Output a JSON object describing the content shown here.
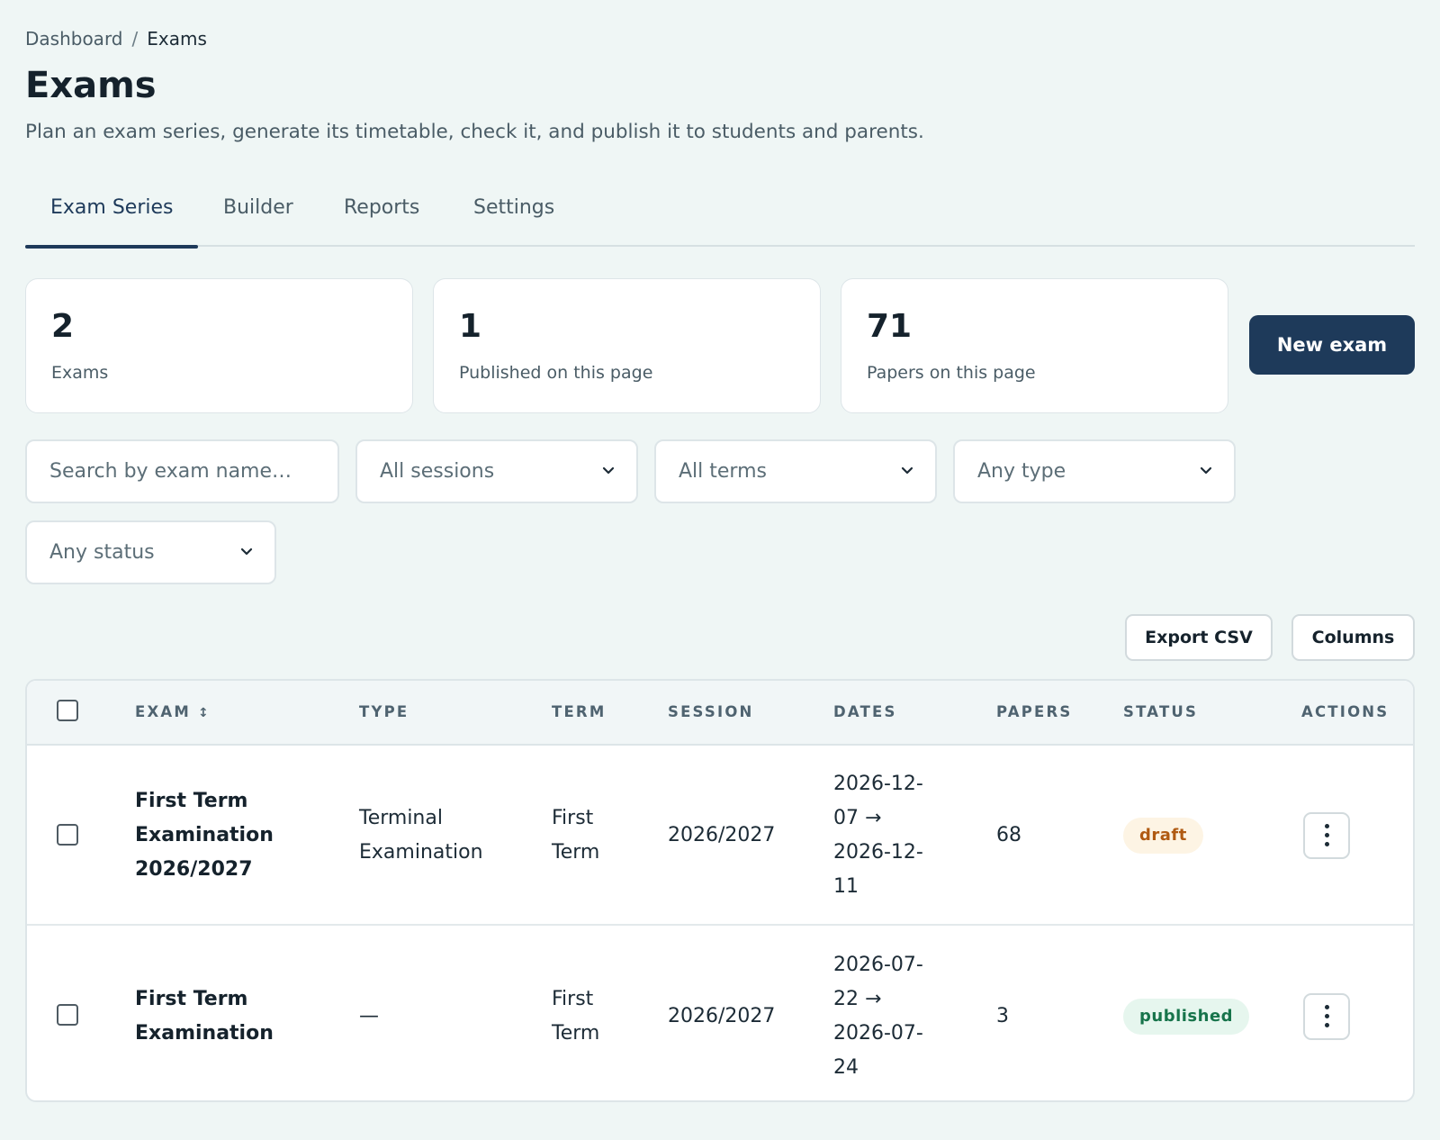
{
  "breadcrumb": {
    "parent": "Dashboard",
    "separator": "/",
    "current": "Exams"
  },
  "page": {
    "title": "Exams",
    "subtitle": "Plan an exam series, generate its timetable, check it, and publish it to students and parents."
  },
  "tabs": [
    {
      "label": "Exam Series",
      "active": true
    },
    {
      "label": "Builder",
      "active": false
    },
    {
      "label": "Reports",
      "active": false
    },
    {
      "label": "Settings",
      "active": false
    }
  ],
  "stats": [
    {
      "value": "2",
      "label": "Exams"
    },
    {
      "value": "1",
      "label": "Published on this page"
    },
    {
      "value": "71",
      "label": "Papers on this page"
    }
  ],
  "actions": {
    "new_exam": "New exam",
    "export_csv": "Export CSV",
    "columns": "Columns"
  },
  "filters": {
    "search_placeholder": "Search by exam name…",
    "session": "All sessions",
    "term": "All terms",
    "type": "Any type",
    "status": "Any status"
  },
  "table": {
    "headers": {
      "exam": "EXAM",
      "type": "TYPE",
      "term": "TERM",
      "session": "SESSION",
      "dates": "DATES",
      "papers": "PAPERS",
      "status": "STATUS",
      "actions": "ACTIONS"
    },
    "rows": [
      {
        "exam_lines": [
          "First Term",
          "Examination",
          "2026/2027"
        ],
        "type_lines": [
          "Terminal",
          "Examination"
        ],
        "term_lines": [
          "First",
          "Term"
        ],
        "session": "2026/2027",
        "dates_lines": [
          "2026-12-",
          "07 →",
          "2026-12-",
          "11"
        ],
        "papers": "68",
        "status": "draft"
      },
      {
        "exam_lines": [
          "First Term",
          "Examination"
        ],
        "type_lines": [
          "—"
        ],
        "term_lines": [
          "First",
          "Term"
        ],
        "session": "2026/2027",
        "dates_lines": [
          "2026-07-",
          "22 →",
          "2026-07-",
          "24"
        ],
        "papers": "3",
        "status": "published"
      }
    ]
  },
  "colors": {
    "page_bg": "#eff6f5",
    "primary": "#1e3a5a",
    "draft_text": "#b05a12",
    "draft_bg": "#fdf4e4",
    "published_text": "#17744b",
    "published_bg": "#e6f6ee"
  },
  "icons": {
    "sort": "sort-icon",
    "dropdown": "chevron-down-icon",
    "row_menu": "kebab-menu-icon"
  }
}
